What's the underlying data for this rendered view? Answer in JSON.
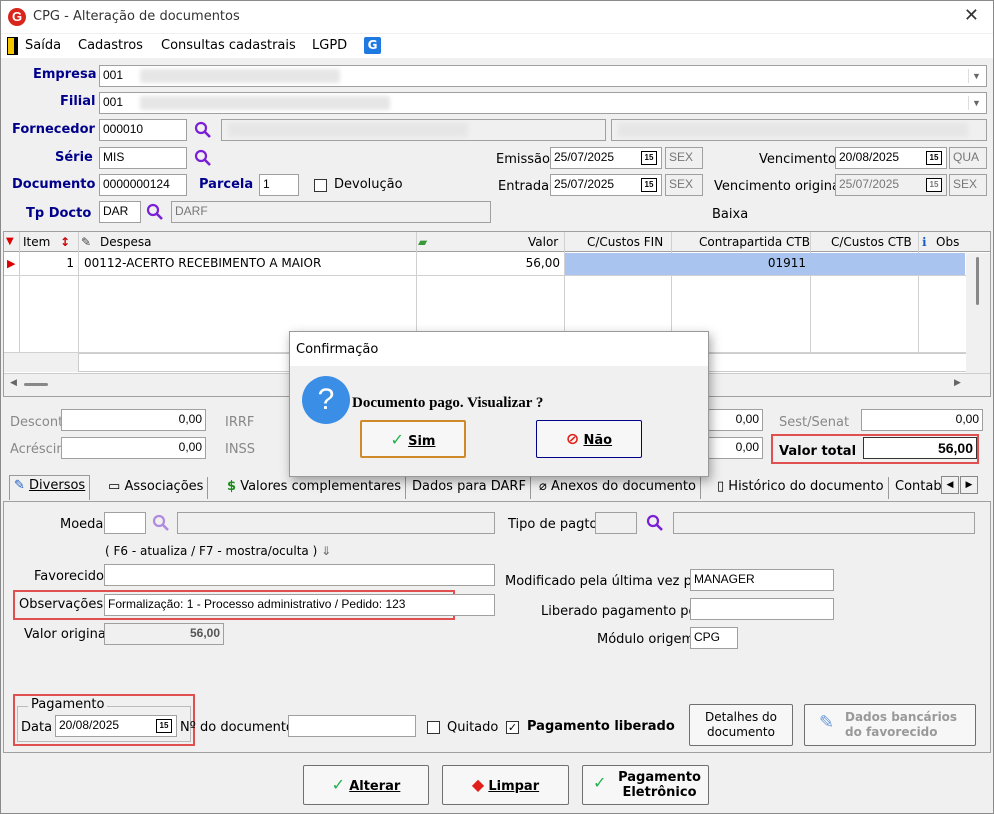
{
  "window": {
    "title": "CPG - Alteração de documentos",
    "logo": "G",
    "close": "✕"
  },
  "menu": [
    "Saída",
    "Cadastros",
    "Consultas cadastrais",
    "LGPD"
  ],
  "header": {
    "empresa_label": "Empresa",
    "empresa_value": "001",
    "filial_label": "Filial",
    "filial_value": "001",
    "fornecedor_label": "Fornecedor",
    "fornecedor_value": "000010",
    "serie_label": "Série",
    "serie_value": "MIS",
    "documento_label": "Documento",
    "documento_value": "0000000124",
    "parcela_label": "Parcela",
    "parcela_value": "1",
    "devolucao_label": "Devolução",
    "tpdocto_label": "Tp Docto",
    "tpdocto_value": "DAR",
    "tpdocto_desc": "DARF",
    "emissao_label": "Emissão",
    "emissao_value": "25/07/2025",
    "emissao_day": "SEX",
    "entrada_label": "Entrada",
    "entrada_value": "25/07/2025",
    "entrada_day": "SEX",
    "vencimento_label": "Vencimento",
    "vencimento_value": "20/08/2025",
    "vencimento_day": "QUA",
    "venc_orig_label": "Vencimento original",
    "venc_orig_value": "25/07/2025",
    "venc_orig_day": "SEX",
    "baixa_label": "Baixa"
  },
  "grid": {
    "columns": {
      "item": "Item",
      "despesa": "Despesa",
      "valor": "Valor",
      "ccfin": "C/Custos FIN",
      "contrapartida": "Contrapartida CTB",
      "ccctb": "C/Custos CTB",
      "obs": "Obs"
    },
    "rows": [
      {
        "item": "1",
        "despesa": "00112-ACERTO RECEBIMENTO A MAIOR",
        "valor": "56,00",
        "contrapartida": "01911"
      }
    ]
  },
  "totals": {
    "desconto_label": "Desconto",
    "desconto_value": "0,00",
    "acrescimo_label": "Acréscimo",
    "acrescimo_value": "0,00",
    "irrf_label": "IRRF",
    "inss_label": "INSS",
    "v1": "0,00",
    "v2": "0,00",
    "sest_label": "Sest/Senat",
    "sest_value": "0,00",
    "valor_total_label": "Valor total",
    "valor_total_value": "56,00"
  },
  "tabs": [
    "Diversos",
    "Associações",
    "Valores complementares",
    "Dados para DARF",
    "Anexos do documento",
    "Histórico do documento",
    "Contabili"
  ],
  "diversos": {
    "moeda_label": "Moeda",
    "tipo_pagto_label": "Tipo de pagto",
    "hint": "( F6 - atualiza / F7 - mostra/oculta )",
    "favorecido_label": "Favorecido",
    "observacoes_label": "Observações",
    "observacoes_value": "Formalização: 1 - Processo administrativo / Pedido: 123",
    "valor_original_label": "Valor original",
    "valor_original_value": "56,00",
    "modificado_label": "Modificado pela última vez por",
    "modificado_value": "MANAGER",
    "liberado_label": "Liberado pagamento por",
    "modulo_label": "Módulo origem",
    "modulo_value": "CPG",
    "pagamento_group": "Pagamento",
    "data_label": "Data",
    "data_value": "20/08/2025",
    "ndoc_label": "Nº do documento",
    "quitado_label": "Quitado",
    "pag_liberado_label": "Pagamento liberado",
    "detalhes_btn": "Detalhes do documento",
    "dados_bancarios_btn": "Dados bancários do favorecido"
  },
  "buttons": {
    "alterar": "Alterar",
    "limpar": "Limpar",
    "pag_eletronico": "Pagamento Eletrônico"
  },
  "dialog": {
    "title": "Confirmação",
    "message": "Documento pago. Visualizar ?",
    "sim": "Sim",
    "nao": "Não"
  },
  "colors": {
    "accent": "#00008b",
    "selected_row": "#a9c4ee",
    "red_box": "#e05050"
  }
}
